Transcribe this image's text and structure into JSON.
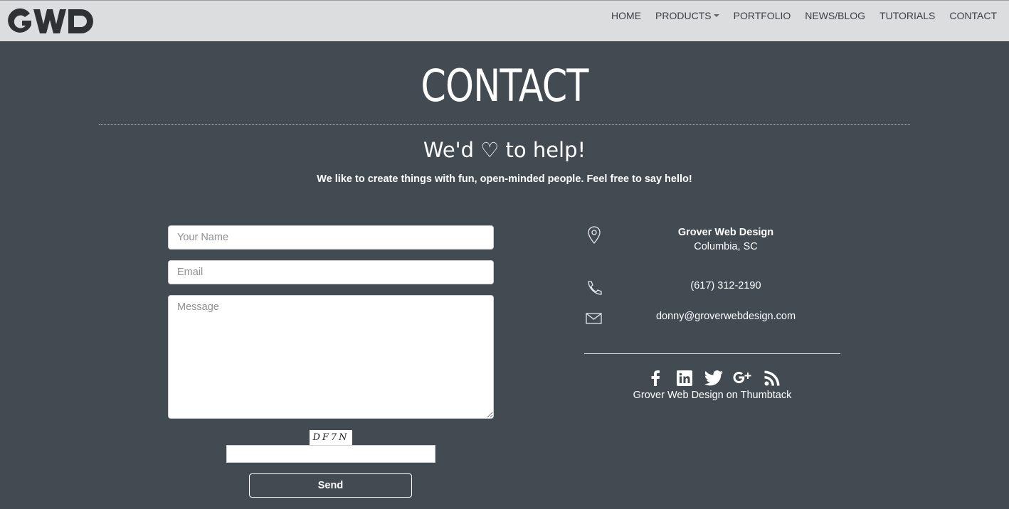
{
  "header": {
    "logo_text": "GWD",
    "nav": [
      {
        "label": "HOME"
      },
      {
        "label": "PRODUCTS"
      },
      {
        "label": "PORTFOLIO"
      },
      {
        "label": "NEWS/BLOG"
      },
      {
        "label": "TUTORIALS"
      },
      {
        "label": "CONTACT"
      }
    ]
  },
  "page": {
    "title": "CONTACT",
    "tagline": "We'd ♡ to help!",
    "subline": "We like to create things with fun, open-minded people. Feel free to say hello!"
  },
  "form": {
    "name_placeholder": "Your Name",
    "email_placeholder": "Email",
    "message_placeholder": "Message",
    "captcha_text": "DF7N",
    "send_label": "Send"
  },
  "contact": {
    "company": "Grover Web Design",
    "city": "Columbia, SC",
    "phone": "(617) 312-2190",
    "email": "donny@groverwebdesign.com",
    "thumbtack": "Grover Web Design on Thumbtack",
    "social_icons": [
      "facebook-icon",
      "linkedin-icon",
      "twitter-icon",
      "google-plus-icon",
      "rss-icon"
    ]
  },
  "colors": {
    "background": "#424a52",
    "header": "#dcdddf",
    "text": "#ffffff"
  }
}
